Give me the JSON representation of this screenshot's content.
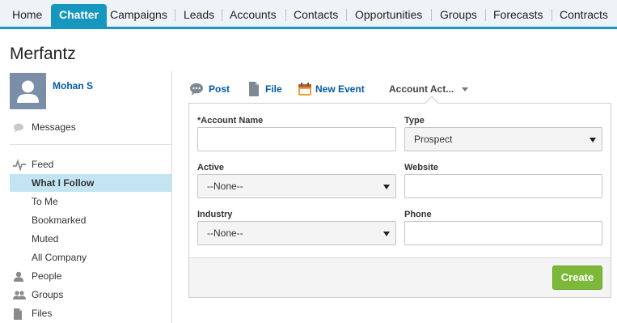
{
  "tabs": [
    {
      "label": "Home",
      "active": false
    },
    {
      "label": "Chatter",
      "active": true
    },
    {
      "label": "Campaigns",
      "active": false
    },
    {
      "label": "Leads",
      "active": false
    },
    {
      "label": "Accounts",
      "active": false
    },
    {
      "label": "Contacts",
      "active": false
    },
    {
      "label": "Opportunities",
      "active": false
    },
    {
      "label": "Groups",
      "active": false
    },
    {
      "label": "Forecasts",
      "active": false
    },
    {
      "label": "Contracts",
      "active": false
    }
  ],
  "page": {
    "title": "Merfantz"
  },
  "user": {
    "name": "Mohan S"
  },
  "sidebar": {
    "messages": {
      "label": "Messages",
      "icon": "speech-bubble-icon"
    },
    "feed": {
      "label": "Feed",
      "icon": "pulse-icon"
    },
    "feed_items": [
      {
        "label": "What I Follow",
        "selected": true
      },
      {
        "label": "To Me",
        "selected": false
      },
      {
        "label": "Bookmarked",
        "selected": false
      },
      {
        "label": "Muted",
        "selected": false
      },
      {
        "label": "All Company",
        "selected": false
      }
    ],
    "people": {
      "label": "People",
      "icon": "person-icon"
    },
    "groups": {
      "label": "Groups",
      "icon": "people-icon"
    },
    "files": {
      "label": "Files",
      "icon": "file-icon"
    }
  },
  "publisher": {
    "post": {
      "label": "Post",
      "icon": "speech-bubble-icon"
    },
    "file": {
      "label": "File",
      "icon": "file-icon"
    },
    "event": {
      "label": "New Event",
      "icon": "calendar-icon"
    },
    "more": {
      "label": "Account Act..."
    }
  },
  "form": {
    "account_name": {
      "label": "*Account Name",
      "value": ""
    },
    "type": {
      "label": "Type",
      "value": "Prospect"
    },
    "active": {
      "label": "Active",
      "value": "--None--"
    },
    "website": {
      "label": "Website",
      "value": ""
    },
    "industry": {
      "label": "Industry",
      "value": "--None--"
    },
    "phone": {
      "label": "Phone",
      "value": ""
    },
    "create_label": "Create"
  },
  "colors": {
    "accent": "#1797c0",
    "link": "#015ba7",
    "create": "#7db939",
    "selected_row": "#c3e5f3"
  }
}
